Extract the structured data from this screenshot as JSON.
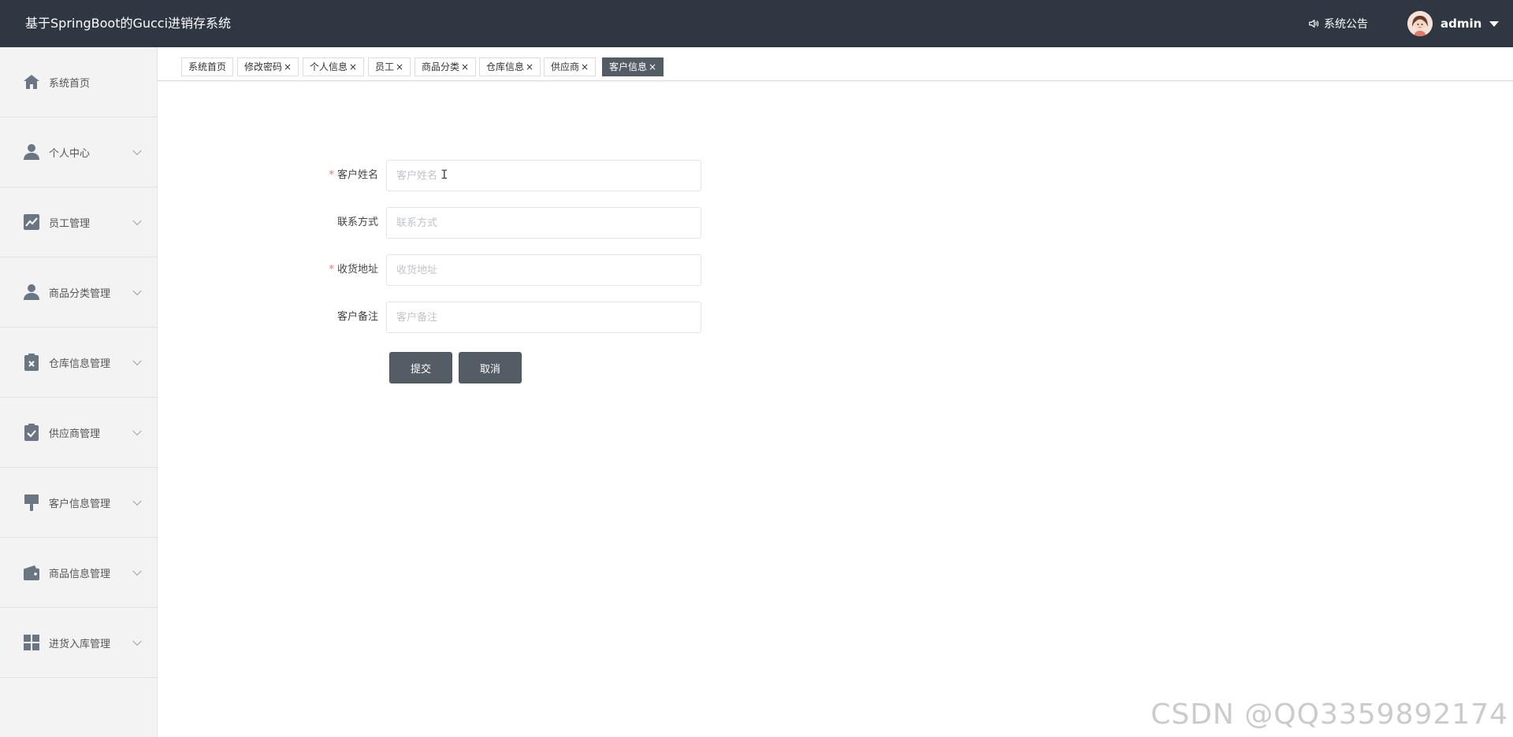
{
  "header": {
    "title": "基于SpringBoot的Gucci进销存系统",
    "notice_label": "系统公告",
    "username": "admin"
  },
  "sidebar": {
    "items": [
      {
        "label": "系统首页",
        "icon": "home-icon",
        "has_submenu": false
      },
      {
        "label": "个人中心",
        "icon": "user-icon",
        "has_submenu": true
      },
      {
        "label": "员工管理",
        "icon": "chart-icon",
        "has_submenu": true
      },
      {
        "label": "商品分类管理",
        "icon": "user-icon",
        "has_submenu": true
      },
      {
        "label": "仓库信息管理",
        "icon": "clipboard-x-icon",
        "has_submenu": true
      },
      {
        "label": "供应商管理",
        "icon": "clipboard-check-icon",
        "has_submenu": true
      },
      {
        "label": "客户信息管理",
        "icon": "brush-icon",
        "has_submenu": true
      },
      {
        "label": "商品信息管理",
        "icon": "wallet-icon",
        "has_submenu": true
      },
      {
        "label": "进货入库管理",
        "icon": "grid-icon",
        "has_submenu": true
      }
    ]
  },
  "tabs": [
    {
      "label": "系统首页",
      "closable": false,
      "active": false
    },
    {
      "label": "修改密码",
      "closable": true,
      "active": false
    },
    {
      "label": "个人信息",
      "closable": true,
      "active": false
    },
    {
      "label": "员工",
      "closable": true,
      "active": false
    },
    {
      "label": "商品分类",
      "closable": true,
      "active": false
    },
    {
      "label": "仓库信息",
      "closable": true,
      "active": false
    },
    {
      "label": "供应商",
      "closable": true,
      "active": false
    },
    {
      "label": "客户信息",
      "closable": true,
      "active": true
    }
  ],
  "tab_close_glyph": "×",
  "form": {
    "fields": [
      {
        "label": "客户姓名",
        "required": true,
        "value": "",
        "placeholder": "客户姓名"
      },
      {
        "label": "联系方式",
        "required": false,
        "value": "",
        "placeholder": "联系方式"
      },
      {
        "label": "收货地址",
        "required": true,
        "value": "",
        "placeholder": "收货地址"
      },
      {
        "label": "客户备注",
        "required": false,
        "value": "",
        "placeholder": "客户备注"
      }
    ],
    "required_mark": "*",
    "submit_label": "提交",
    "cancel_label": "取消"
  },
  "watermark": "CSDN @QQ3359892174",
  "colors": {
    "header_bg": "#2f3742",
    "sidebar_bg": "#f3f3f4",
    "accent": "#545c66",
    "required": "#f56c6c"
  }
}
